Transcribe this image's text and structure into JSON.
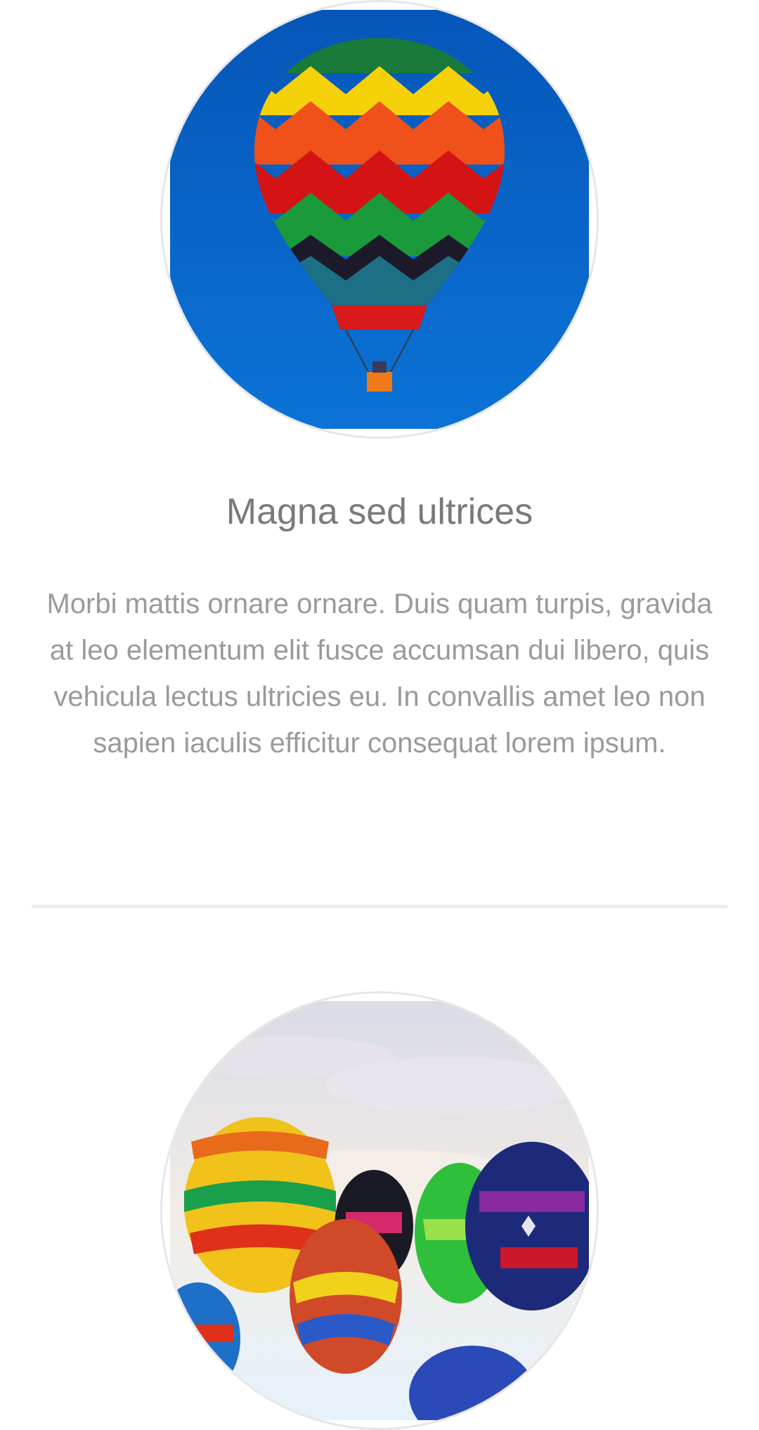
{
  "features": [
    {
      "image_alt": "Hot air balloon against blue sky",
      "title": "Magna sed ultrices",
      "text": "Morbi mattis ornare ornare. Duis quam turpis, gravida at leo elementum elit fusce accumsan dui libero, quis vehicula lectus ultricies eu. In convallis amet leo non sapien iaculis efficitur consequat lorem ipsum."
    },
    {
      "image_alt": "Group of hot air balloons"
    }
  ],
  "colors": {
    "title": "#7a7a7a",
    "body_text": "#9a9a9a",
    "divider": "#ececec",
    "ring": "#e6e6e6",
    "sky_blue": "#0a66c8"
  }
}
